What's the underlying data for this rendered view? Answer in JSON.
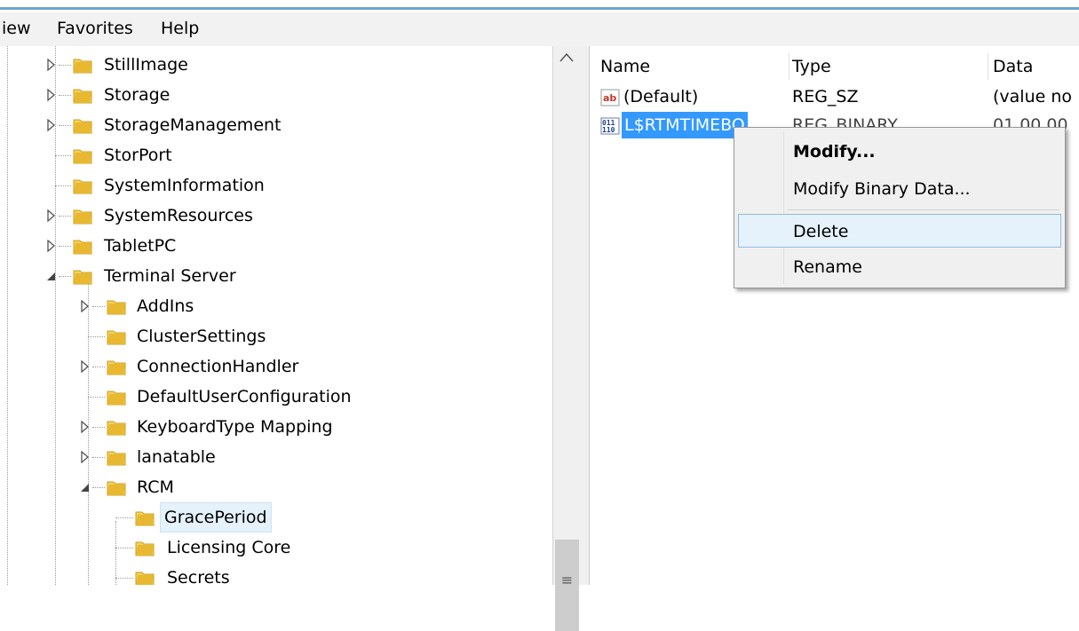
{
  "menubar": {
    "view": "iew",
    "favorites": "Favorites",
    "help": "Help"
  },
  "tree": {
    "items": [
      {
        "label": "StillImage"
      },
      {
        "label": "Storage"
      },
      {
        "label": "StorageManagement"
      },
      {
        "label": "StorPort"
      },
      {
        "label": "SystemInformation"
      },
      {
        "label": "SystemResources"
      },
      {
        "label": "TabletPC"
      },
      {
        "label": "Terminal Server"
      },
      {
        "label": "AddIns"
      },
      {
        "label": "ClusterSettings"
      },
      {
        "label": "ConnectionHandler"
      },
      {
        "label": "DefaultUserConfiguration"
      },
      {
        "label": "KeyboardType Mapping"
      },
      {
        "label": "lanatable"
      },
      {
        "label": "RCM"
      },
      {
        "label": "GracePeriod"
      },
      {
        "label": "Licensing Core"
      },
      {
        "label": "Secrets"
      }
    ]
  },
  "list": {
    "columns": [
      "Name",
      "Type",
      "Data"
    ],
    "rows": [
      {
        "name": "(Default)",
        "type": "REG_SZ",
        "data": "(value no"
      },
      {
        "name": "L$RTMTIMEBO",
        "type": "REG_BINARY",
        "data": "01 00 00"
      }
    ]
  },
  "context_menu": {
    "items": [
      "Modify...",
      "Modify Binary Data...",
      "Delete",
      "Rename"
    ],
    "highlighted": "Delete"
  },
  "colors": {
    "selection": "#3399ff",
    "folder": "#e8b830",
    "highlight": "#e5f1fb"
  }
}
